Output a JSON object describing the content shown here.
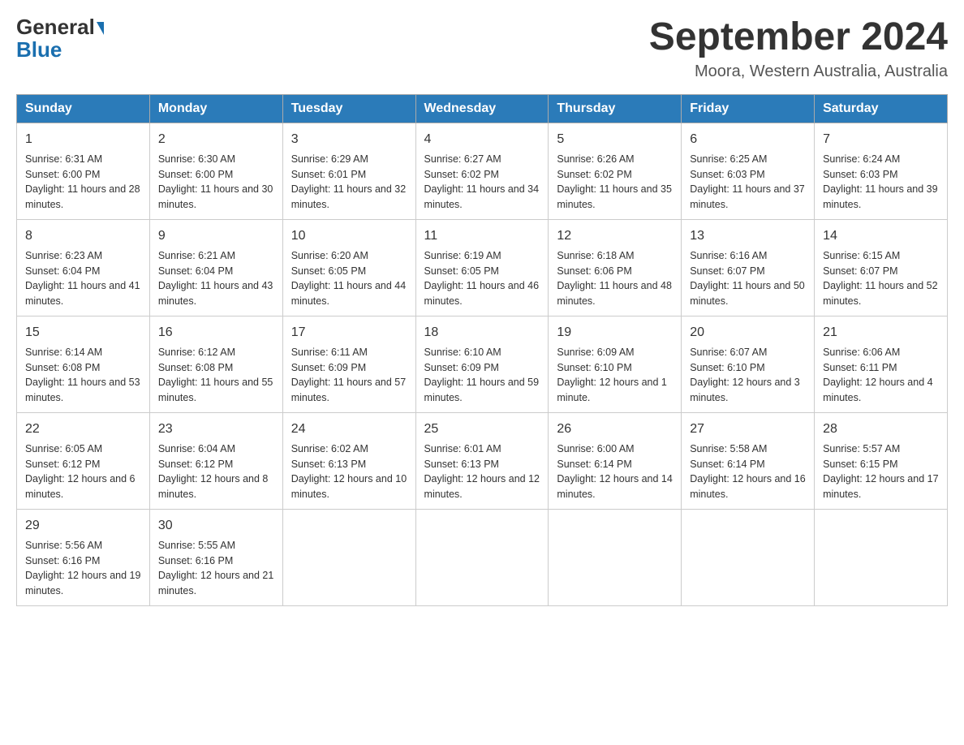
{
  "header": {
    "logo_general": "General",
    "logo_blue": "Blue",
    "title": "September 2024",
    "subtitle": "Moora, Western Australia, Australia"
  },
  "weekdays": [
    "Sunday",
    "Monday",
    "Tuesday",
    "Wednesday",
    "Thursday",
    "Friday",
    "Saturday"
  ],
  "weeks": [
    [
      {
        "day": "1",
        "sunrise": "Sunrise: 6:31 AM",
        "sunset": "Sunset: 6:00 PM",
        "daylight": "Daylight: 11 hours and 28 minutes."
      },
      {
        "day": "2",
        "sunrise": "Sunrise: 6:30 AM",
        "sunset": "Sunset: 6:00 PM",
        "daylight": "Daylight: 11 hours and 30 minutes."
      },
      {
        "day": "3",
        "sunrise": "Sunrise: 6:29 AM",
        "sunset": "Sunset: 6:01 PM",
        "daylight": "Daylight: 11 hours and 32 minutes."
      },
      {
        "day": "4",
        "sunrise": "Sunrise: 6:27 AM",
        "sunset": "Sunset: 6:02 PM",
        "daylight": "Daylight: 11 hours and 34 minutes."
      },
      {
        "day": "5",
        "sunrise": "Sunrise: 6:26 AM",
        "sunset": "Sunset: 6:02 PM",
        "daylight": "Daylight: 11 hours and 35 minutes."
      },
      {
        "day": "6",
        "sunrise": "Sunrise: 6:25 AM",
        "sunset": "Sunset: 6:03 PM",
        "daylight": "Daylight: 11 hours and 37 minutes."
      },
      {
        "day": "7",
        "sunrise": "Sunrise: 6:24 AM",
        "sunset": "Sunset: 6:03 PM",
        "daylight": "Daylight: 11 hours and 39 minutes."
      }
    ],
    [
      {
        "day": "8",
        "sunrise": "Sunrise: 6:23 AM",
        "sunset": "Sunset: 6:04 PM",
        "daylight": "Daylight: 11 hours and 41 minutes."
      },
      {
        "day": "9",
        "sunrise": "Sunrise: 6:21 AM",
        "sunset": "Sunset: 6:04 PM",
        "daylight": "Daylight: 11 hours and 43 minutes."
      },
      {
        "day": "10",
        "sunrise": "Sunrise: 6:20 AM",
        "sunset": "Sunset: 6:05 PM",
        "daylight": "Daylight: 11 hours and 44 minutes."
      },
      {
        "day": "11",
        "sunrise": "Sunrise: 6:19 AM",
        "sunset": "Sunset: 6:05 PM",
        "daylight": "Daylight: 11 hours and 46 minutes."
      },
      {
        "day": "12",
        "sunrise": "Sunrise: 6:18 AM",
        "sunset": "Sunset: 6:06 PM",
        "daylight": "Daylight: 11 hours and 48 minutes."
      },
      {
        "day": "13",
        "sunrise": "Sunrise: 6:16 AM",
        "sunset": "Sunset: 6:07 PM",
        "daylight": "Daylight: 11 hours and 50 minutes."
      },
      {
        "day": "14",
        "sunrise": "Sunrise: 6:15 AM",
        "sunset": "Sunset: 6:07 PM",
        "daylight": "Daylight: 11 hours and 52 minutes."
      }
    ],
    [
      {
        "day": "15",
        "sunrise": "Sunrise: 6:14 AM",
        "sunset": "Sunset: 6:08 PM",
        "daylight": "Daylight: 11 hours and 53 minutes."
      },
      {
        "day": "16",
        "sunrise": "Sunrise: 6:12 AM",
        "sunset": "Sunset: 6:08 PM",
        "daylight": "Daylight: 11 hours and 55 minutes."
      },
      {
        "day": "17",
        "sunrise": "Sunrise: 6:11 AM",
        "sunset": "Sunset: 6:09 PM",
        "daylight": "Daylight: 11 hours and 57 minutes."
      },
      {
        "day": "18",
        "sunrise": "Sunrise: 6:10 AM",
        "sunset": "Sunset: 6:09 PM",
        "daylight": "Daylight: 11 hours and 59 minutes."
      },
      {
        "day": "19",
        "sunrise": "Sunrise: 6:09 AM",
        "sunset": "Sunset: 6:10 PM",
        "daylight": "Daylight: 12 hours and 1 minute."
      },
      {
        "day": "20",
        "sunrise": "Sunrise: 6:07 AM",
        "sunset": "Sunset: 6:10 PM",
        "daylight": "Daylight: 12 hours and 3 minutes."
      },
      {
        "day": "21",
        "sunrise": "Sunrise: 6:06 AM",
        "sunset": "Sunset: 6:11 PM",
        "daylight": "Daylight: 12 hours and 4 minutes."
      }
    ],
    [
      {
        "day": "22",
        "sunrise": "Sunrise: 6:05 AM",
        "sunset": "Sunset: 6:12 PM",
        "daylight": "Daylight: 12 hours and 6 minutes."
      },
      {
        "day": "23",
        "sunrise": "Sunrise: 6:04 AM",
        "sunset": "Sunset: 6:12 PM",
        "daylight": "Daylight: 12 hours and 8 minutes."
      },
      {
        "day": "24",
        "sunrise": "Sunrise: 6:02 AM",
        "sunset": "Sunset: 6:13 PM",
        "daylight": "Daylight: 12 hours and 10 minutes."
      },
      {
        "day": "25",
        "sunrise": "Sunrise: 6:01 AM",
        "sunset": "Sunset: 6:13 PM",
        "daylight": "Daylight: 12 hours and 12 minutes."
      },
      {
        "day": "26",
        "sunrise": "Sunrise: 6:00 AM",
        "sunset": "Sunset: 6:14 PM",
        "daylight": "Daylight: 12 hours and 14 minutes."
      },
      {
        "day": "27",
        "sunrise": "Sunrise: 5:58 AM",
        "sunset": "Sunset: 6:14 PM",
        "daylight": "Daylight: 12 hours and 16 minutes."
      },
      {
        "day": "28",
        "sunrise": "Sunrise: 5:57 AM",
        "sunset": "Sunset: 6:15 PM",
        "daylight": "Daylight: 12 hours and 17 minutes."
      }
    ],
    [
      {
        "day": "29",
        "sunrise": "Sunrise: 5:56 AM",
        "sunset": "Sunset: 6:16 PM",
        "daylight": "Daylight: 12 hours and 19 minutes."
      },
      {
        "day": "30",
        "sunrise": "Sunrise: 5:55 AM",
        "sunset": "Sunset: 6:16 PM",
        "daylight": "Daylight: 12 hours and 21 minutes."
      },
      null,
      null,
      null,
      null,
      null
    ]
  ]
}
